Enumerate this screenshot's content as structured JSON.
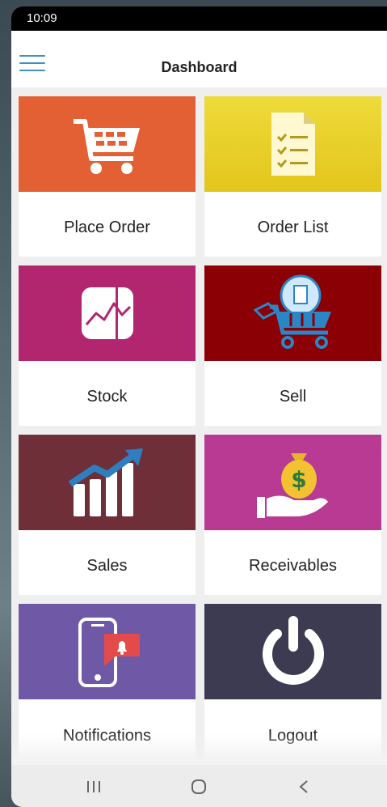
{
  "status": {
    "time": "10:09"
  },
  "header": {
    "title": "Dashboard"
  },
  "tiles": [
    {
      "label": "Place Order",
      "bg": "#e35f34",
      "icon": "cart-icon"
    },
    {
      "label": "Order List",
      "bg": "#e8d12b",
      "icon": "clipboard-list-icon"
    },
    {
      "label": "Stock",
      "bg": "#b2266f",
      "icon": "line-chart-icon"
    },
    {
      "label": "Sell",
      "bg": "#8a0004",
      "icon": "cart-tag-icon"
    },
    {
      "label": "Sales",
      "bg": "#6e2f38",
      "icon": "bar-growth-icon"
    },
    {
      "label": "Receivables",
      "bg": "#b83a93",
      "icon": "money-bag-hand-icon"
    },
    {
      "label": "Notifications",
      "bg": "#6f58a6",
      "icon": "phone-bell-icon"
    },
    {
      "label": "Logout",
      "bg": "#3c3b52",
      "icon": "power-icon"
    }
  ],
  "colors": {
    "accent": "#3f8fc4"
  }
}
